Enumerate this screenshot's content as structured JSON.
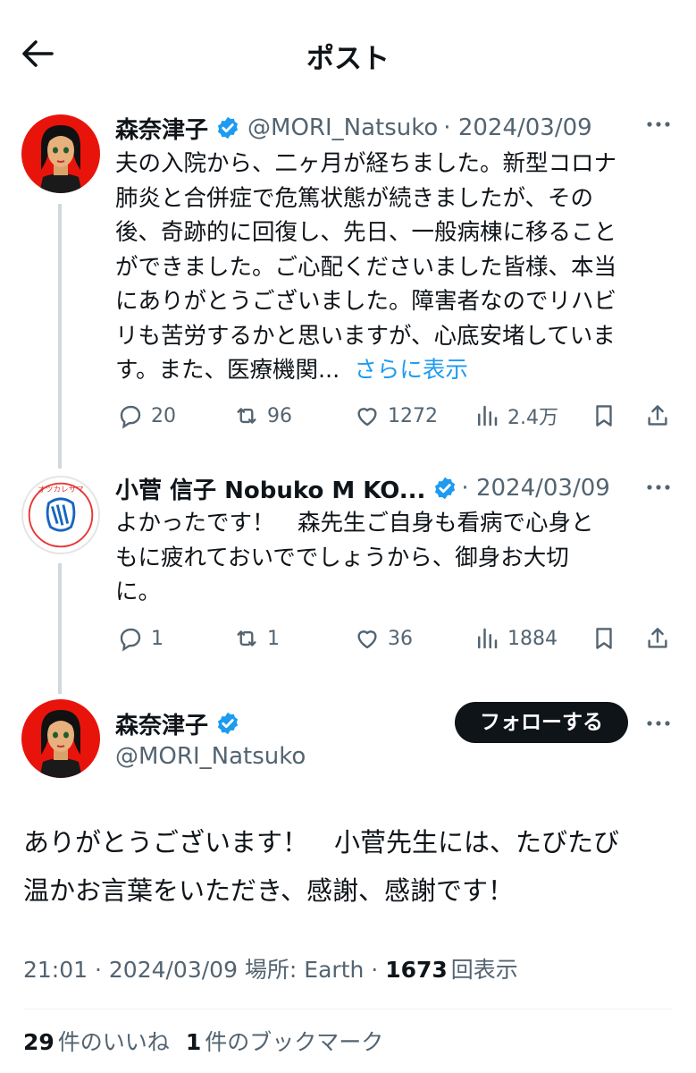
{
  "header": {
    "title": "ポスト"
  },
  "tweet1": {
    "name": "森奈津子",
    "handle": "@MORI_Natsuko",
    "date": "· 2024/03/09",
    "text_lines": [
      "夫の入院から、二ヶ月が経ちました。新型コロナ",
      "肺炎と合併症で危篤状態が続きましたが、その",
      "後、奇跡的に回復し、先日、一般病棟に移ること",
      "ができました。ご心配くださいました皆様、本当",
      "にありがとうございました。障害者なのでリハビ",
      "リも苦労するかと思いますが、心底安堵していま",
      "す。また、医療機関..."
    ],
    "more": "さらに表示",
    "replies": "20",
    "retweets": "96",
    "likes": "1272",
    "views": "2.4万"
  },
  "tweet2": {
    "name": "小菅 信子 Nobuko M KO...",
    "date": "· 2024/03/09",
    "text_lines": [
      "よかったです！　森先生ご自身も看病で心身と",
      "もに疲れておいででしょうから、御身お大切",
      "に。"
    ],
    "avatar_text": "オツカレサマ",
    "replies": "1",
    "retweets": "1",
    "likes": "36",
    "views": "1884"
  },
  "main": {
    "name": "森奈津子",
    "handle": "@MORI_Natsuko",
    "follow_label": "フォローする",
    "text_lines": [
      "ありがとうございます！　小菅先生には、たびたび",
      "温かお言葉をいただき、感謝、感謝です！"
    ],
    "meta_time": "21:01 · 2024/03/09 場所: Earth · ",
    "meta_views_count": "1673",
    "meta_views_label": "回表示",
    "likes_count": "29",
    "likes_label": "件のいいね",
    "bookmarks_count": "1",
    "bookmarks_label": "件のブックマーク"
  },
  "icons": {
    "back": "arrow-left-icon",
    "reply": "speech-bubble-icon",
    "retweet": "retweet-icon",
    "like": "heart-icon",
    "views": "bar-chart-icon",
    "bookmark": "bookmark-icon",
    "share": "share-icon",
    "verified": "verified-badge-icon",
    "more": "more-dots-icon"
  },
  "colors": {
    "link": "#1d9bf0",
    "verified": "#1d9bf0",
    "muted": "#536471"
  }
}
